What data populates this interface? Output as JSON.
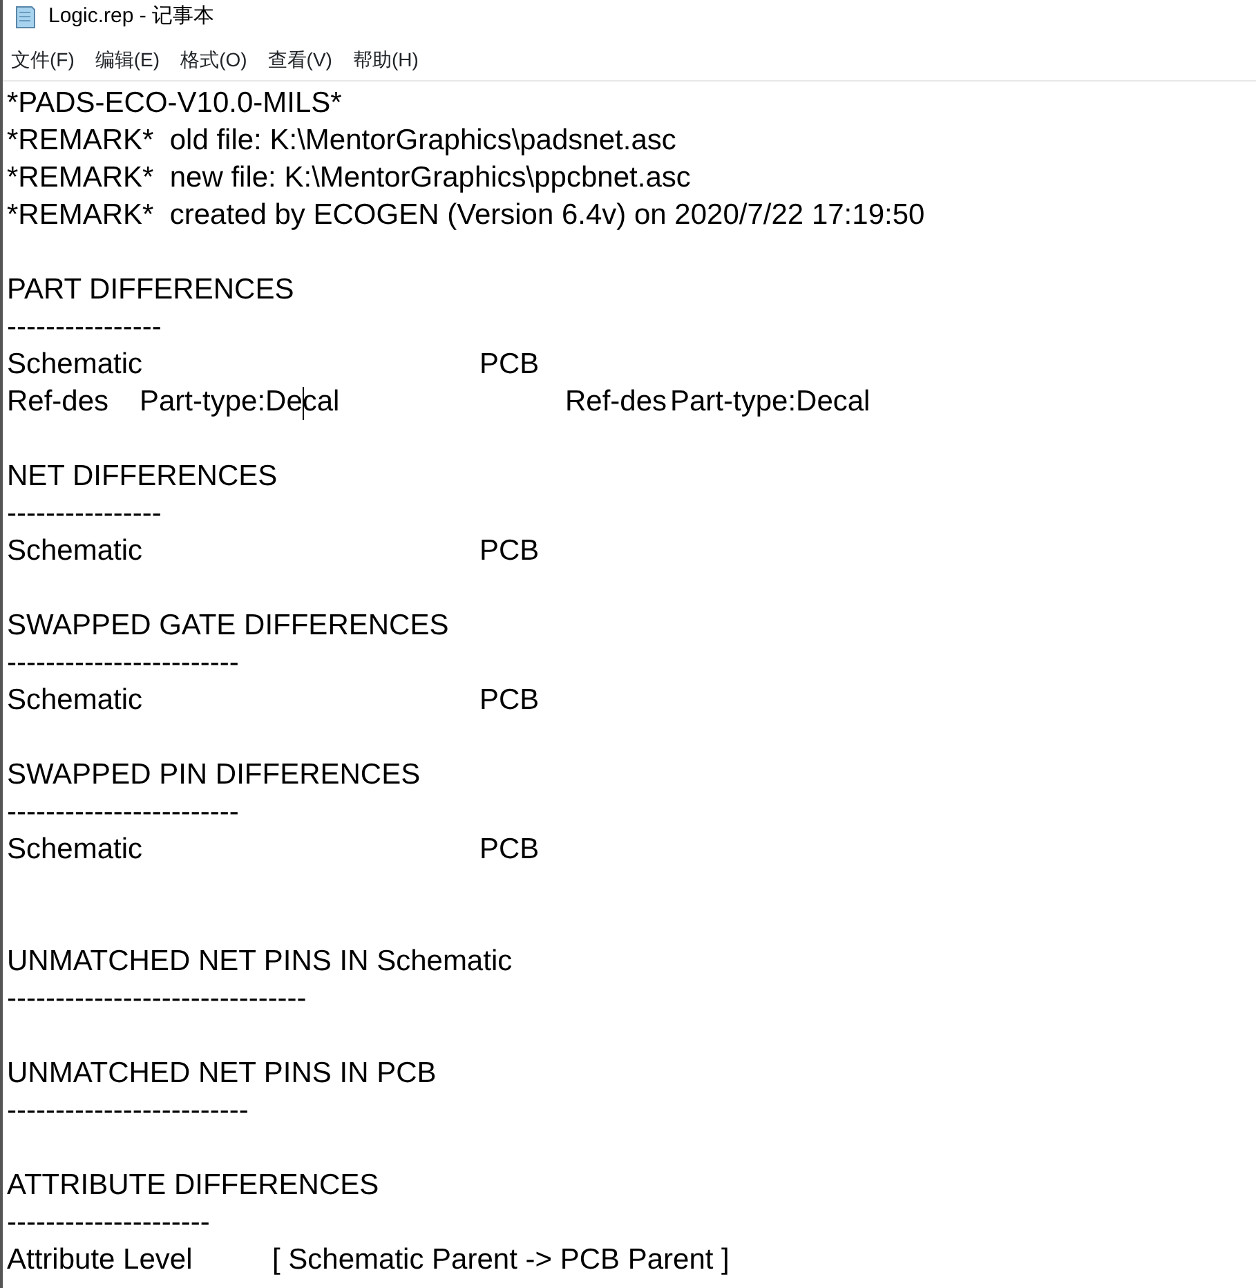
{
  "window": {
    "title": "Logic.rep - 记事本"
  },
  "menu": [
    "文件(F)",
    "编辑(E)",
    "格式(O)",
    "查看(V)",
    "帮助(H)"
  ],
  "lines": [
    {
      "kind": "text",
      "cells": [
        "*PADS-ECO-V10.0-MILS*"
      ]
    },
    {
      "kind": "text",
      "cells": [
        "*REMARK*  old file: K:\\MentorGraphics\\padsnet.asc"
      ]
    },
    {
      "kind": "text",
      "cells": [
        "*REMARK*  new file: K:\\MentorGraphics\\ppcbnet.asc"
      ]
    },
    {
      "kind": "text",
      "cells": [
        "*REMARK*  created by ECOGEN (Version 6.4v) on 2020/7/22 17:19:50"
      ]
    },
    {
      "kind": "blank"
    },
    {
      "kind": "text",
      "cells": [
        "PART DIFFERENCES"
      ]
    },
    {
      "kind": "text",
      "cells": [
        "----------------"
      ]
    },
    {
      "kind": "columns",
      "cells": [
        "Schematic",
        "PCB"
      ]
    },
    {
      "kind": "refdes",
      "cells": [
        "Ref-des",
        {
          "caret_between": [
            "Part-type:De",
            "cal"
          ]
        },
        "Ref-des",
        "Part-type:Decal"
      ]
    },
    {
      "kind": "blank"
    },
    {
      "kind": "text",
      "cells": [
        "NET DIFFERENCES"
      ]
    },
    {
      "kind": "text",
      "cells": [
        "----------------"
      ]
    },
    {
      "kind": "columns",
      "cells": [
        "Schematic",
        "PCB"
      ]
    },
    {
      "kind": "blank"
    },
    {
      "kind": "text",
      "cells": [
        "SWAPPED GATE DIFFERENCES"
      ]
    },
    {
      "kind": "text",
      "cells": [
        "------------------------"
      ]
    },
    {
      "kind": "columns",
      "cells": [
        "Schematic",
        "PCB"
      ]
    },
    {
      "kind": "blank"
    },
    {
      "kind": "text",
      "cells": [
        "SWAPPED PIN DIFFERENCES"
      ]
    },
    {
      "kind": "text",
      "cells": [
        "------------------------"
      ]
    },
    {
      "kind": "columns",
      "cells": [
        "Schematic",
        "PCB"
      ]
    },
    {
      "kind": "blank"
    },
    {
      "kind": "blank"
    },
    {
      "kind": "text",
      "cells": [
        "UNMATCHED NET PINS IN Schematic"
      ]
    },
    {
      "kind": "text",
      "cells": [
        "-------------------------------"
      ]
    },
    {
      "kind": "blank"
    },
    {
      "kind": "text",
      "cells": [
        "UNMATCHED NET PINS IN PCB"
      ]
    },
    {
      "kind": "text",
      "cells": [
        "-------------------------"
      ]
    },
    {
      "kind": "blank"
    },
    {
      "kind": "text",
      "cells": [
        "ATTRIBUTE DIFFERENCES"
      ]
    },
    {
      "kind": "text",
      "cells": [
        "---------------------"
      ]
    },
    {
      "kind": "attribute",
      "cells": [
        "Attribute Level",
        "[ Schematic Parent -> PCB Parent ]"
      ]
    }
  ]
}
